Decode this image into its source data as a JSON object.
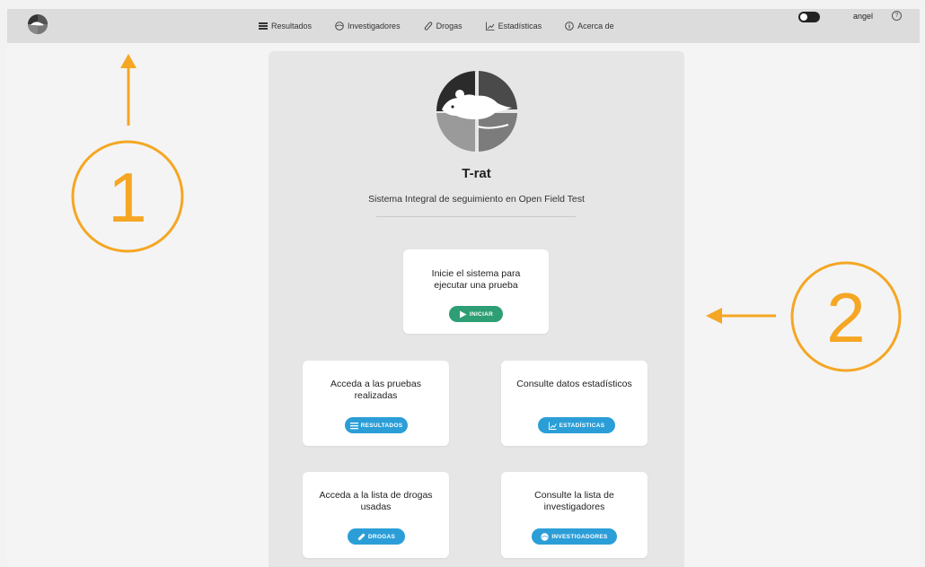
{
  "nav": {
    "items": [
      {
        "label": "Resultados",
        "icon": "list-icon"
      },
      {
        "label": "Investigadores",
        "icon": "people-icon"
      },
      {
        "label": "Drogas",
        "icon": "pill-icon"
      },
      {
        "label": "Estadísticas",
        "icon": "chart-icon"
      },
      {
        "label": "Acerca de",
        "icon": "info-icon"
      }
    ],
    "username": "angel",
    "help_symbol": "?"
  },
  "main": {
    "title": "T-rat",
    "subtitle": "Sistema Integral de seguimiento en Open Field Test",
    "start_card": {
      "text": "Inicie el sistema para ejecutar una prueba",
      "button": "INICIAR"
    },
    "cards": [
      {
        "text": "Acceda a las pruebas realizadas",
        "button": "RESULTADOS"
      },
      {
        "text": "Consulte datos estadísticos",
        "button": "ESTADÍSTICAS"
      },
      {
        "text": "Acceda a la lista de drogas usadas",
        "button": "DROGAS"
      },
      {
        "text": "Consulte la lista de investigadores",
        "button": "INVESTIGADORES"
      }
    ]
  },
  "annotations": {
    "one": "1",
    "two": "2"
  },
  "colors": {
    "accent_green": "#2e9e74",
    "accent_blue": "#2b9ed8",
    "annotation_orange": "#f5a623"
  }
}
